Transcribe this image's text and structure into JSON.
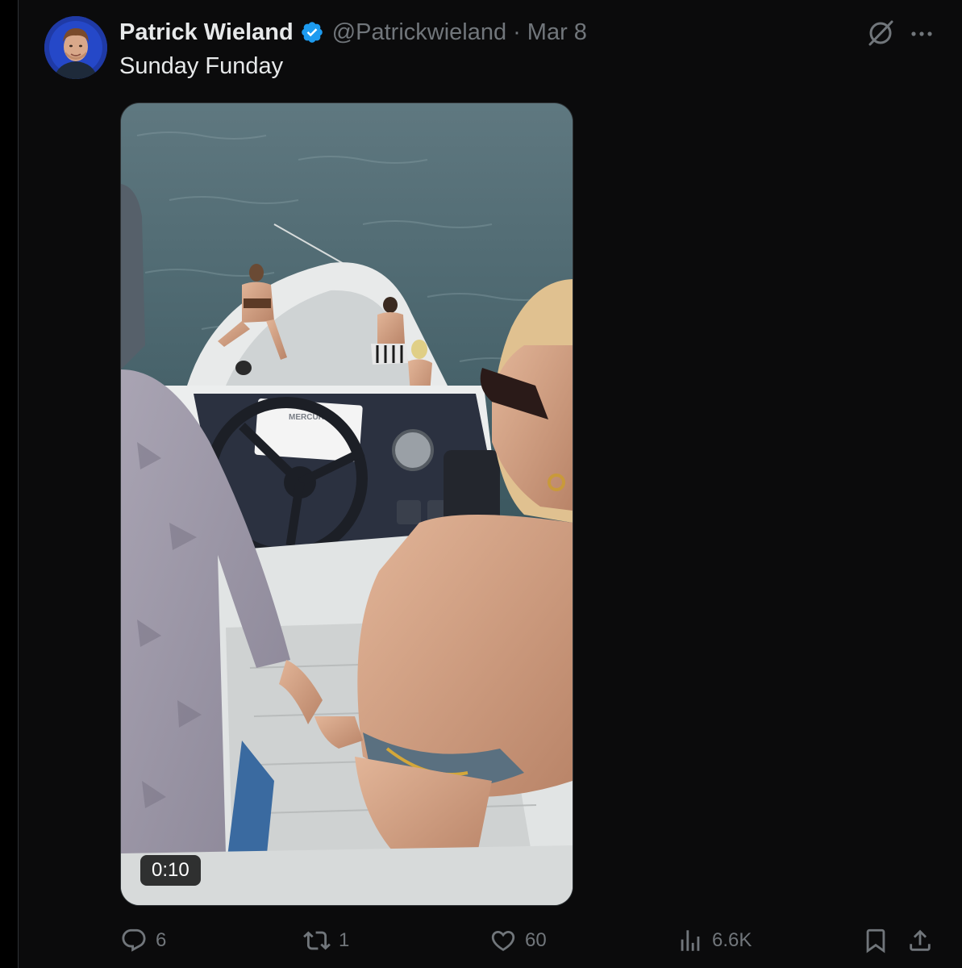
{
  "tweet": {
    "display_name": "Patrick Wieland",
    "handle": "@Patrickwieland",
    "separator": "·",
    "date": "Mar 8",
    "text": "Sunday Funday",
    "verified": true
  },
  "media": {
    "type": "video",
    "duration": "0:10",
    "console_label": "MERCURY"
  },
  "actions": {
    "replies": "6",
    "reposts": "1",
    "likes": "60",
    "views": "6.6K"
  },
  "icons": {
    "verified": "verified-badge-icon",
    "grok": "grok-icon",
    "more": "more-icon",
    "reply": "reply-icon",
    "repost": "repost-icon",
    "like": "heart-icon",
    "views": "views-icon",
    "bookmark": "bookmark-icon",
    "share": "share-icon"
  },
  "colors": {
    "background": "#0b0b0c",
    "primary_text": "#e7e9ea",
    "secondary_text": "#71767b",
    "verified_blue": "#1d9bf0",
    "border": "#2f3336"
  }
}
